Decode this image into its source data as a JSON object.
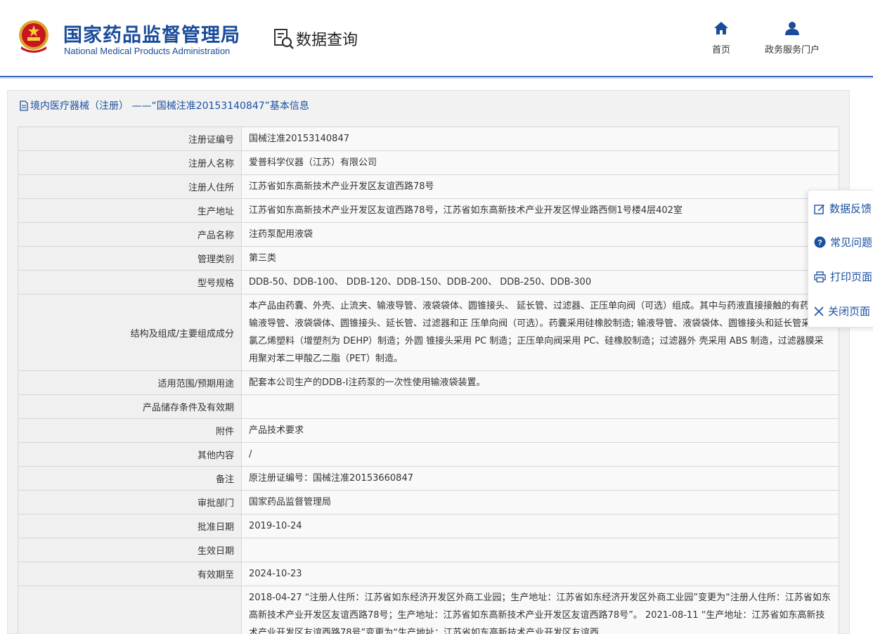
{
  "header": {
    "org_name_cn": "国家药品监督管理局",
    "org_name_en": "National Medical Products Administration",
    "section_title": "数据查询",
    "nav": [
      {
        "label": "首页",
        "icon": "home-icon"
      },
      {
        "label": "政务服务门户",
        "icon": "user-icon"
      }
    ]
  },
  "panel": {
    "title": "境内医疗器械（注册） ——“国械注准20153140847”基本信息"
  },
  "rows": [
    {
      "label": "注册证编号",
      "value": "国械注准20153140847"
    },
    {
      "label": "注册人名称",
      "value": "爱普科学仪器（江苏）有限公司"
    },
    {
      "label": "注册人住所",
      "value": "江苏省如东高新技术产业开发区友谊西路78号"
    },
    {
      "label": "生产地址",
      "value": "江苏省如东高新技术产业开发区友谊西路78号，江苏省如东高新技术产业开发区悍业路西侧1号楼4层402室"
    },
    {
      "label": "产品名称",
      "value": "注药泵配用液袋"
    },
    {
      "label": "管理类别",
      "value": "第三类"
    },
    {
      "label": "型号规格",
      "value": "DDB-50、DDB-100、 DDB-120、DDB-150、DDB-200、 DDB-250、DDB-300"
    },
    {
      "label": "结构及组成/主要组成成分",
      "value": "本产品由药囊、外壳、止流夹、输液导管、液袋袋体、圆锥接头、 延长管、过滤器、正压单向阀（可选）组成。其中与药液直接接触的有药囊、输液导管、液袋袋体、圆锥接头、延长管、过滤器和正 压单向阀（可选）。药囊采用硅橡胶制造; 输液导管、液袋袋体、圆锥接头和延长管采用聚氯乙烯塑料（增塑剂为 DEHP）制造；外圆 锥接头采用 PC 制造；正压单向阀采用 PC、硅橡胶制造；过滤器外 壳采用 ABS 制造，过滤器膜采用聚对苯二甲酸乙二脂（PET）制造。"
    },
    {
      "label": "适用范围/预期用途",
      "value": "配套本公司生产的DDB-Ⅰ注药泵的一次性使用输液袋装置。"
    },
    {
      "label": "产品储存条件及有效期",
      "value": ""
    },
    {
      "label": "附件",
      "value": "产品技术要求"
    },
    {
      "label": "其他内容",
      "value": "/"
    },
    {
      "label": "备注",
      "value": "原注册证编号：国械注准20153660847"
    },
    {
      "label": "审批部门",
      "value": "国家药品监督管理局"
    },
    {
      "label": "批准日期",
      "value": "2019-10-24"
    },
    {
      "label": "生效日期",
      "value": ""
    },
    {
      "label": "有效期至",
      "value": "2024-10-23"
    },
    {
      "label": "",
      "value": "2018-04-27 “注册人住所：江苏省如东经济开发区外商工业园；生产地址：江苏省如东经济开发区外商工业园”变更为“注册人住所：江苏省如东高新技术产业开发区友谊西路78号；生产地址：江苏省如东高新技术产业开发区友谊西路78号”。 2021-08-11 “生产地址：江苏省如东高新技术产业开发区友谊西路78号”变更为“生产地址：江苏省如东高新技术产业开发区友谊西"
    }
  ],
  "side_tools": [
    {
      "label": "数据反馈",
      "icon": "edit-icon"
    },
    {
      "label": "常见问题",
      "icon": "question-icon"
    },
    {
      "label": "打印页面",
      "icon": "print-icon"
    },
    {
      "label": "关闭页面",
      "icon": "close-icon"
    }
  ],
  "colors": {
    "brand_blue": "#1a4c9c",
    "link_blue": "#1b50a0",
    "label_bg": "#f0f0f0",
    "panel_bg": "#f2f2f2"
  }
}
